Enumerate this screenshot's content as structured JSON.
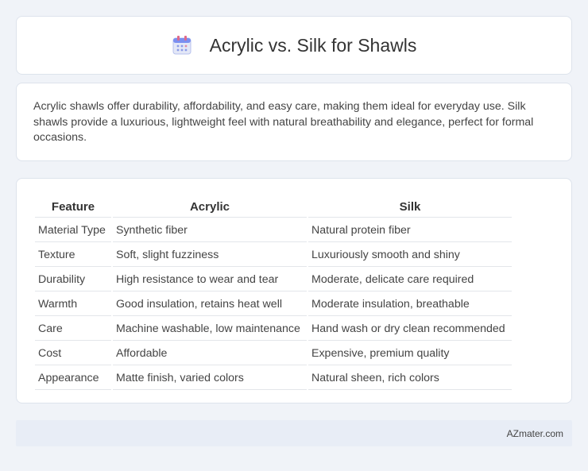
{
  "header": {
    "title": "Acrylic vs. Silk for Shawls",
    "icon": "calendar-icon"
  },
  "intro": {
    "text": "Acrylic shawls offer durability, affordability, and easy care, making them ideal for everyday use. Silk shawls provide a luxurious, lightweight feel with natural breathability and elegance, perfect for formal occasions."
  },
  "table": {
    "headers": [
      "Feature",
      "Acrylic",
      "Silk"
    ],
    "rows": [
      [
        "Material Type",
        "Synthetic fiber",
        "Natural protein fiber"
      ],
      [
        "Texture",
        "Soft, slight fuzziness",
        "Luxuriously smooth and shiny"
      ],
      [
        "Durability",
        "High resistance to wear and tear",
        "Moderate, delicate care required"
      ],
      [
        "Warmth",
        "Good insulation, retains heat well",
        "Moderate insulation, breathable"
      ],
      [
        "Care",
        "Machine washable, low maintenance",
        "Hand wash or dry clean recommended"
      ],
      [
        "Cost",
        "Affordable",
        "Expensive, premium quality"
      ],
      [
        "Appearance",
        "Matte finish, varied colors",
        "Natural sheen, rich colors"
      ]
    ]
  },
  "footer": {
    "brand": "AZmater.com"
  }
}
